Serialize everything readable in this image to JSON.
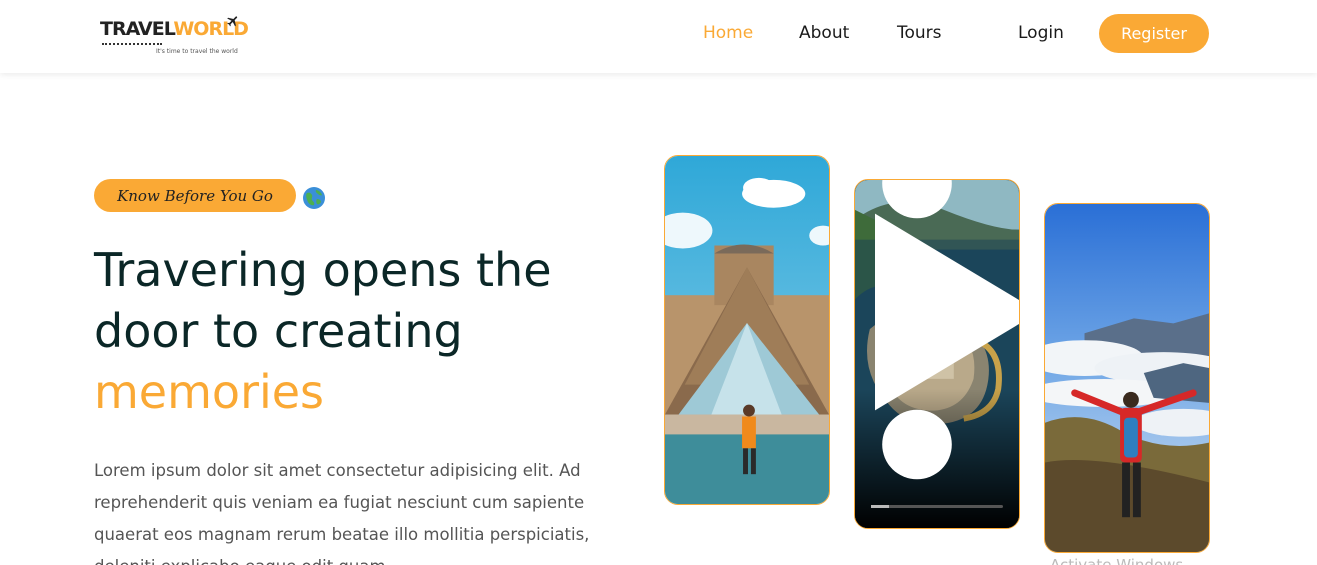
{
  "header": {
    "logo": {
      "word1": "TRAVEL",
      "word2": "WORLD",
      "tagline": "It's time to travel the world"
    },
    "nav": [
      {
        "label": "Home",
        "active": true
      },
      {
        "label": "About",
        "active": false
      },
      {
        "label": "Tours",
        "active": false
      }
    ],
    "login_label": "Login",
    "register_label": "Register"
  },
  "hero": {
    "subtitle": "Know Before You Go",
    "title_line1": "Travering opens the",
    "title_line2": "door to creating",
    "title_highlight": "memories",
    "description": "Lorem ipsum dolor sit amet consectetur adipisicing elit. Ad reprehenderit quis veniam ea fugiat nesciunt cum sapiente quaerat eos magnam rerum beatae illo mollitia perspiciatis, deleniti explicabo eaque odit quam.",
    "video_progress": 0.14,
    "caption": "Activate Windows"
  },
  "colors": {
    "accent": "#faa935",
    "heading": "#0b2727",
    "text": "#555555"
  },
  "icons": [
    "plane-icon",
    "globe-icon",
    "play-icon",
    "more-vertical-icon"
  ]
}
